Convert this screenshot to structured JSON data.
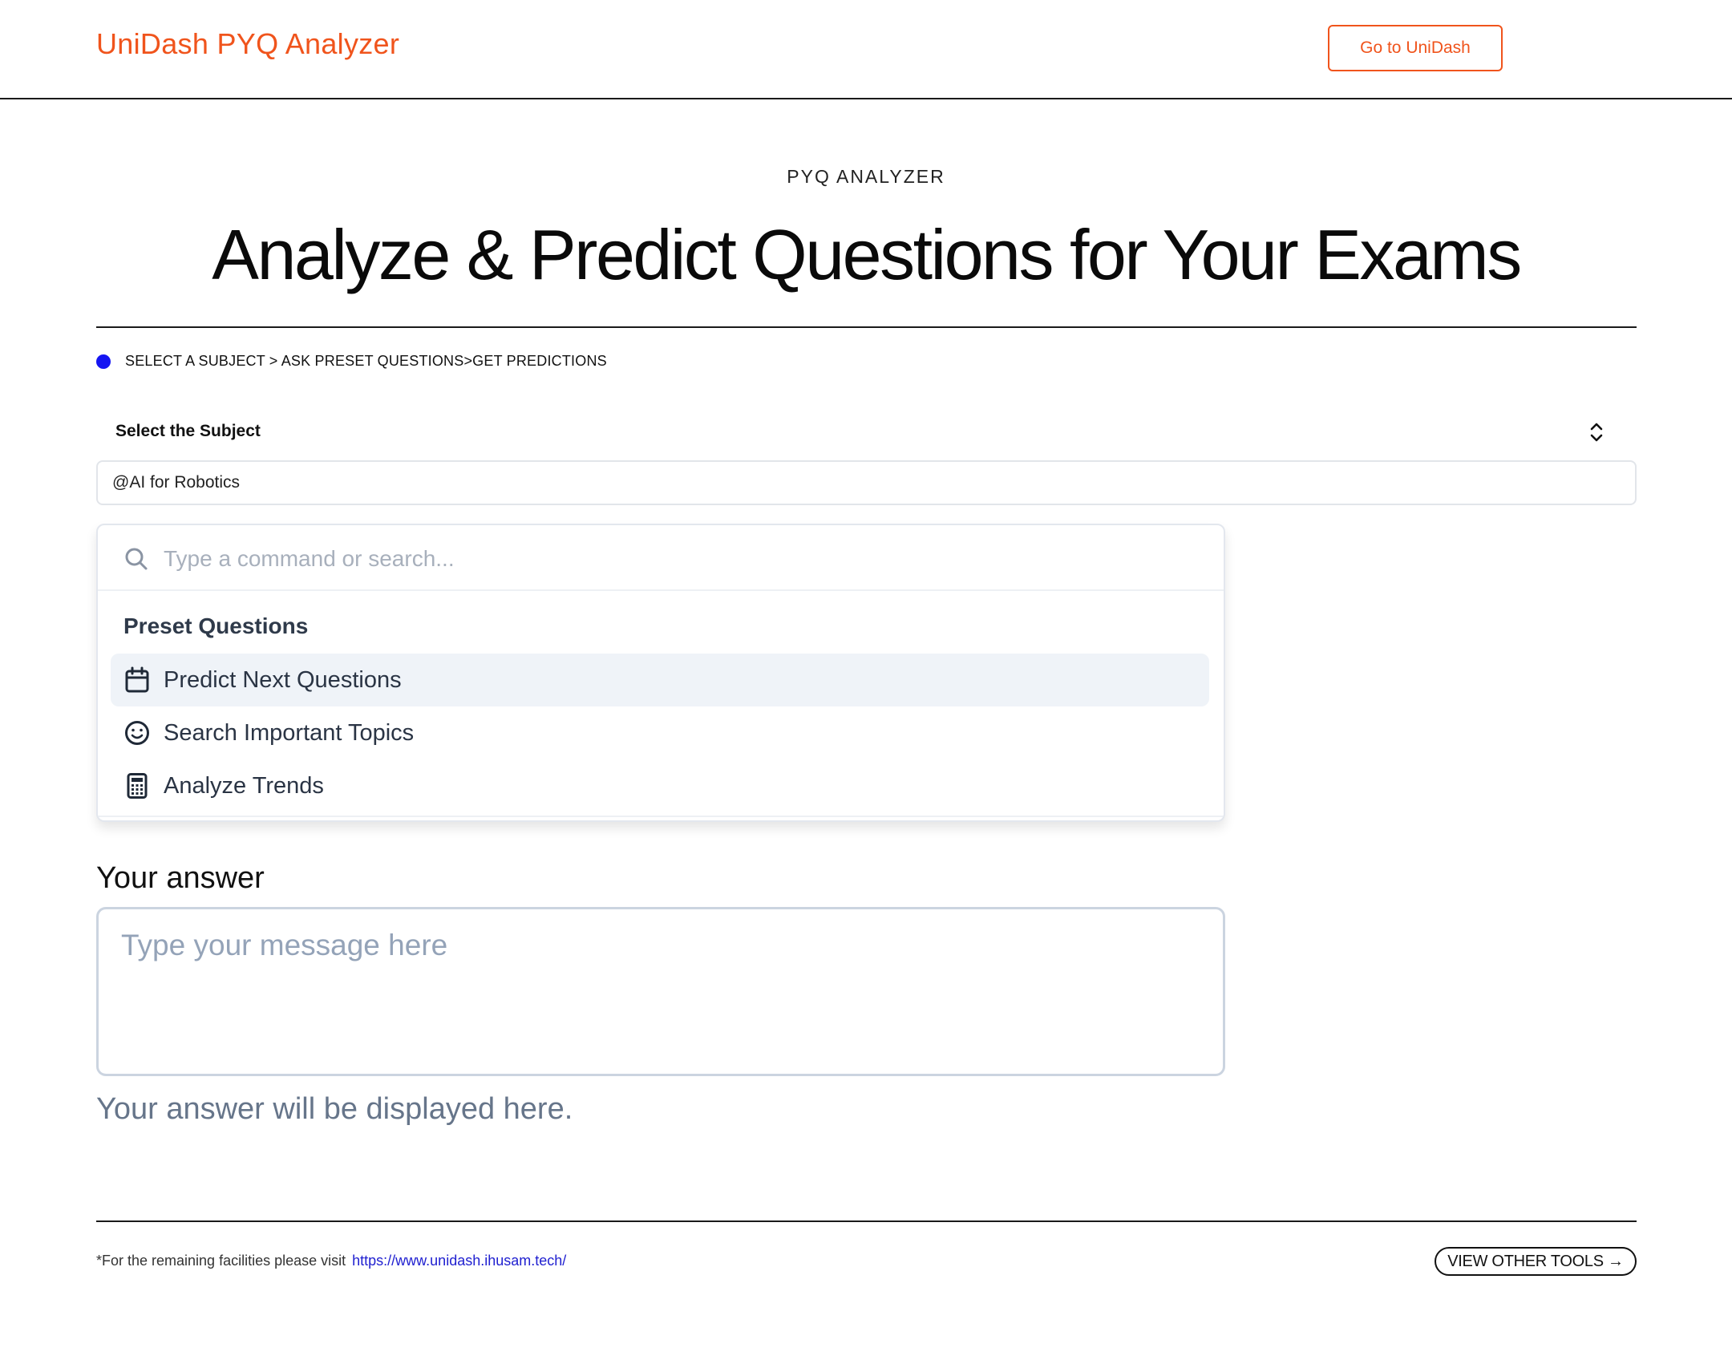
{
  "header": {
    "brand": "UniDash PYQ Analyzer",
    "cta_label": "Go to UniDash"
  },
  "hero": {
    "eyebrow": "PYQ ANALYZER",
    "title": "Analyze & Predict Questions for Your Exams"
  },
  "steps": {
    "text": "SELECT A SUBJECT > ASK PRESET QUESTIONS>GET PREDICTIONS"
  },
  "subject": {
    "label": "Select the Subject",
    "value": "@AI for Robotics"
  },
  "palette": {
    "search_placeholder": "Type a command or search...",
    "group_heading": "Preset Questions",
    "items": [
      {
        "label": "Predict Next Questions",
        "icon": "calendar-icon",
        "active": true
      },
      {
        "label": "Search Important Topics",
        "icon": "smile-icon",
        "active": false
      },
      {
        "label": "Analyze Trends",
        "icon": "calculator-icon",
        "active": false
      }
    ]
  },
  "answer": {
    "heading": "Your answer",
    "placeholder": "Type your message here",
    "output": "Your answer will be displayed here."
  },
  "footer": {
    "note": "*For the remaining facilities please visit",
    "link": "https://www.unidash.ihusam.tech/",
    "view_tools": "VIEW OTHER TOOLS →"
  },
  "colors": {
    "brand": "#f0541c",
    "step_dot": "#1515f2",
    "link": "#2020d0",
    "active_item_bg": "#eff3f8"
  }
}
